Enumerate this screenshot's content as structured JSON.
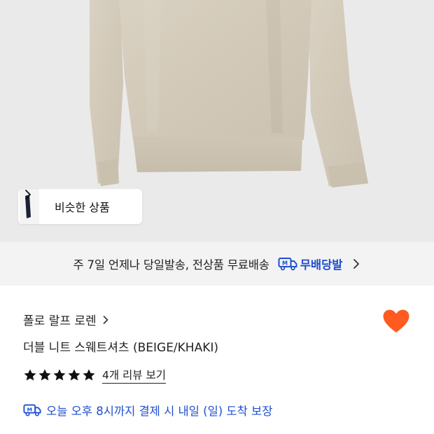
{
  "hero": {
    "similar_products_label": "비슷한 상품",
    "chevron_icon": "chevron-right-icon"
  },
  "shipping": {
    "text": "주 7일 언제나 당일발송, 전상품 무료배송",
    "badge_label": "무배당발",
    "badge_icon": "delivery-truck-icon",
    "badge_color": "#1f4fd1"
  },
  "product": {
    "brand": "폴로 랄프 로렌",
    "name": "더블 니트 스웨트셔츠 (BEIGE/KHAKI)",
    "heart_color": "#ff5a1f",
    "rating_stars": 5,
    "review_link": "4개 리뷰 보기"
  },
  "delivery": {
    "text": "오늘 오후 8시까지 결제 시 내일 (일) 도착 보장",
    "icon": "delivery-truck-icon"
  }
}
